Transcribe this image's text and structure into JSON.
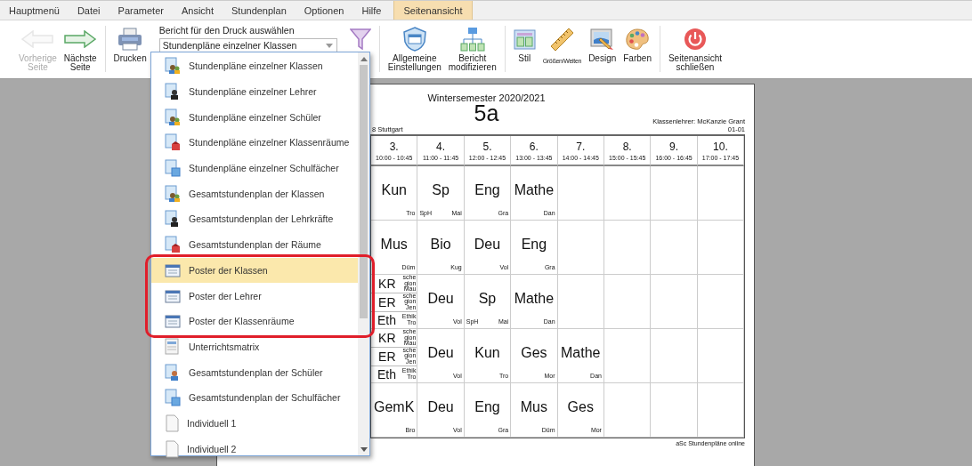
{
  "menu": {
    "tabs": [
      {
        "label": "Hauptmenü",
        "selected": false
      },
      {
        "label": "Datei",
        "selected": false
      },
      {
        "label": "Parameter",
        "selected": false
      },
      {
        "label": "Ansicht",
        "selected": false
      },
      {
        "label": "Stundenplan",
        "selected": false
      },
      {
        "label": "Optionen",
        "selected": false
      },
      {
        "label": "Hilfe",
        "selected": false
      },
      {
        "label": "Seitenansicht",
        "selected": true
      }
    ]
  },
  "toolbar": {
    "groups": [
      [
        {
          "kind": "back",
          "label": "Vorherige Seite",
          "disabled": true
        },
        {
          "kind": "forward",
          "label": "Nächste Seite",
          "disabled": false
        }
      ],
      [
        {
          "kind": "print",
          "label": "Drucken",
          "disabled": false
        },
        {
          "kind": "select",
          "label": "Bericht für den Druck auswählen",
          "value": "Stundenpläne einzelner Klassen"
        },
        {
          "kind": "filter",
          "disabled": false
        }
      ],
      [
        {
          "kind": "settings",
          "label": "Allgemeine Einstellungen",
          "disabled": false
        },
        {
          "kind": "modify",
          "label": "Bericht modifizieren",
          "disabled": false
        }
      ],
      [
        {
          "kind": "style",
          "label": "Stil",
          "disabled": false
        },
        {
          "kind": "sizes",
          "label": "Größen/Weiten",
          "disabled": false
        },
        {
          "kind": "design",
          "label": "Design",
          "disabled": false
        },
        {
          "kind": "colors",
          "label": "Farben",
          "disabled": false
        }
      ],
      [
        {
          "kind": "close",
          "label": "Seitenansicht schließen",
          "disabled": false
        }
      ]
    ]
  },
  "dropdown": {
    "items": [
      {
        "label": "Stundenpläne einzelner Klassen",
        "kind": "group",
        "selected": false,
        "highlighted": false
      },
      {
        "label": "Stundenpläne einzelner Lehrer",
        "kind": "person",
        "selected": false,
        "highlighted": false
      },
      {
        "label": "Stundenpläne einzelner Schüler",
        "kind": "group",
        "selected": false,
        "highlighted": false
      },
      {
        "label": "Stundenpläne einzelner Klassenräume",
        "kind": "room",
        "selected": false,
        "highlighted": false
      },
      {
        "label": "Stundenpläne einzelner Schulfächer",
        "kind": "book",
        "selected": false,
        "highlighted": false
      },
      {
        "label": "Gesamtstundenplan der Klassen",
        "kind": "group",
        "selected": false,
        "highlighted": false
      },
      {
        "label": "Gesamtstundenplan der Lehrkräfte",
        "kind": "person",
        "selected": false,
        "highlighted": false
      },
      {
        "label": "Gesamtstundenplan der Räume",
        "kind": "room",
        "selected": false,
        "highlighted": false
      },
      {
        "label": "Poster der Klassen",
        "kind": "calendar",
        "selected": true,
        "highlighted": true
      },
      {
        "label": "Poster der Lehrer",
        "kind": "calendar",
        "selected": false,
        "highlighted": true
      },
      {
        "label": "Poster der Klassenräume",
        "kind": "calendar",
        "selected": false,
        "highlighted": true
      },
      {
        "label": "Unterrichtsmatrix",
        "kind": "matrix",
        "selected": false,
        "highlighted": false
      },
      {
        "label": "Gesamtstundenplan der Schüler",
        "kind": "student",
        "selected": false,
        "highlighted": false
      },
      {
        "label": "Gesamtstundenplan der Schulfächer",
        "kind": "book",
        "selected": false,
        "highlighted": false
      },
      {
        "label": "Individuell 1",
        "kind": "page",
        "selected": false,
        "highlighted": false
      },
      {
        "label": "Individuell 2",
        "kind": "page",
        "selected": false,
        "highlighted": false
      }
    ]
  },
  "page": {
    "semester": "Wintersemester 2020/2021",
    "class_name": "5a",
    "school": "8 Stuttgart",
    "class_teacher": "Klassenlehrer: McKanzie Grant",
    "room": "01-01",
    "footer": "aSc Stundenpläne online",
    "periods": [
      {
        "number": "3.",
        "time": "10:00 - 10:45"
      },
      {
        "number": "4.",
        "time": "11:00 - 11:45"
      },
      {
        "number": "5.",
        "time": "12:00 - 12:45"
      },
      {
        "number": "6.",
        "time": "13:00 - 13:45"
      },
      {
        "number": "7.",
        "time": "14:00 - 14:45"
      },
      {
        "number": "8.",
        "time": "15:00 - 15:45"
      },
      {
        "number": "9.",
        "time": "16:00 - 16:45"
      },
      {
        "number": "10.",
        "time": "17:00 - 17:45"
      }
    ],
    "rows": [
      [
        {
          "kind": "lesson",
          "subject": "Kun",
          "teacher": "Tro"
        },
        {
          "kind": "lesson",
          "subject": "Sp",
          "room": "SpH",
          "teacher": "Mai"
        },
        {
          "kind": "lesson",
          "subject": "Eng",
          "teacher": "Gra"
        },
        {
          "kind": "lesson",
          "subject": "Mathe",
          "teacher": "Dan"
        },
        {
          "kind": "empty"
        },
        {
          "kind": "empty"
        },
        {
          "kind": "empty"
        },
        {
          "kind": "empty"
        }
      ],
      [
        {
          "kind": "lesson",
          "subject": "Mus",
          "teacher": "Düm"
        },
        {
          "kind": "lesson",
          "subject": "Bio",
          "teacher": "Kug"
        },
        {
          "kind": "lesson",
          "subject": "Deu",
          "teacher": "Vol"
        },
        {
          "kind": "lesson",
          "subject": "Eng",
          "teacher": "Gra"
        },
        {
          "kind": "empty"
        },
        {
          "kind": "empty"
        },
        {
          "kind": "empty"
        },
        {
          "kind": "empty"
        }
      ],
      [
        {
          "kind": "split",
          "parts": [
            {
              "subject": "KR",
              "name_parts": [
                "sche",
                "gion"
              ],
              "teacher": "Mau"
            },
            {
              "subject": "ER",
              "name_parts": [
                "sche",
                "gion"
              ],
              "teacher": "Jen"
            },
            {
              "subject": "Eth",
              "name_parts": [
                "Ethik"
              ],
              "teacher": "Tro"
            }
          ]
        },
        {
          "kind": "lesson",
          "subject": "Deu",
          "teacher": "Vol"
        },
        {
          "kind": "lesson",
          "subject": "Sp",
          "room": "SpH",
          "teacher": "Mai"
        },
        {
          "kind": "lesson",
          "subject": "Mathe",
          "teacher": "Dan"
        },
        {
          "kind": "empty"
        },
        {
          "kind": "empty"
        },
        {
          "kind": "empty"
        },
        {
          "kind": "empty"
        }
      ],
      [
        {
          "kind": "split",
          "parts": [
            {
              "subject": "KR",
              "name_parts": [
                "sche",
                "gion"
              ],
              "teacher": "Mau"
            },
            {
              "subject": "ER",
              "name_parts": [
                "sche",
                "gion"
              ],
              "teacher": "Jen"
            },
            {
              "subject": "Eth",
              "name_parts": [
                "Ethik"
              ],
              "teacher": "Tro"
            }
          ]
        },
        {
          "kind": "lesson",
          "subject": "Deu",
          "teacher": "Vol"
        },
        {
          "kind": "lesson",
          "subject": "Kun",
          "teacher": "Tro"
        },
        {
          "kind": "lesson",
          "subject": "Ges",
          "teacher": "Mor"
        },
        {
          "kind": "lesson",
          "subject": "Mathe",
          "teacher": "Dan"
        },
        {
          "kind": "empty"
        },
        {
          "kind": "empty"
        },
        {
          "kind": "empty"
        }
      ],
      [
        {
          "kind": "lesson",
          "subject": "GemK",
          "teacher": "Bro"
        },
        {
          "kind": "lesson",
          "subject": "Deu",
          "teacher": "Vol"
        },
        {
          "kind": "lesson",
          "subject": "Eng",
          "teacher": "Gra"
        },
        {
          "kind": "lesson",
          "subject": "Mus",
          "teacher": "Düm"
        },
        {
          "kind": "lesson",
          "subject": "Ges",
          "teacher": "Mor"
        },
        {
          "kind": "empty"
        },
        {
          "kind": "empty"
        },
        {
          "kind": "empty"
        }
      ]
    ]
  }
}
